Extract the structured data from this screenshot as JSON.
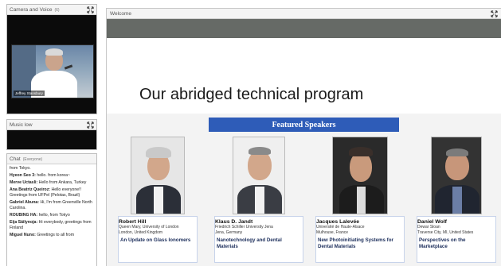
{
  "camera_pod": {
    "title": "Camera and Voice",
    "subtitle": "(6)",
    "presenter_name": "Jeffrey Stansbury"
  },
  "music_pod": {
    "title": "Music low"
  },
  "chat_pod": {
    "title": "Chat",
    "subtitle": "(Everyone)",
    "messages": [
      {
        "author": "",
        "text": "from Tokyo."
      },
      {
        "author": "Hyeon Seo 3:",
        "text": "hello. from korea~"
      },
      {
        "author": "Merve Uctasli:",
        "text": "Hello from Ankara, Turkey"
      },
      {
        "author": "Ana Beatriz Queiroz:",
        "text": "Hello everyone!! Greetings from UFPel (Pelotas, Brazil)"
      },
      {
        "author": "Gabriel Abuna:",
        "text": "Hi, I'm from Greenville North Carolina."
      },
      {
        "author": "ROUBING HA:",
        "text": "hello,    from Tokyo"
      },
      {
        "author": "Eija Säilynoja:",
        "text": "Hi everybody, greetings from Finland"
      },
      {
        "author": "Miguel Nuno:",
        "text": "Greetings to all from"
      }
    ]
  },
  "stage": {
    "title": "Welcome",
    "slide": {
      "heading": "Our abridged technical program",
      "banner": "Featured Speakers",
      "speakers": [
        {
          "name": "Robert Hill",
          "affiliation_1": "Queen Mary, University of London",
          "affiliation_2": "London, United Kingdom",
          "talk": "An Update on Glass Ionomers"
        },
        {
          "name": "Klaus D. Jandt",
          "affiliation_1": "Friedrich Schiller University Jena",
          "affiliation_2": "Jena, Germany",
          "talk": "Nanotechnology and Dental Materials"
        },
        {
          "name": "Jacques Lalevée",
          "affiliation_1": "Université de Haute-Alsace",
          "affiliation_2": "Mulhouse, France",
          "talk": "New Photoinitiating Systems for Dental Materials"
        },
        {
          "name": "Daniel Wolf",
          "affiliation_1": "Dewar Sloan",
          "affiliation_2": "Traverse City, MI, United States",
          "talk": "Perspectives on the Marketplace"
        }
      ]
    }
  },
  "icons": {
    "pod_expand": "expand-arrows-icon"
  },
  "colors": {
    "banner": "#2e5cb8",
    "slide_topbar": "#666a66",
    "pod_background": "#0b0b0b"
  }
}
